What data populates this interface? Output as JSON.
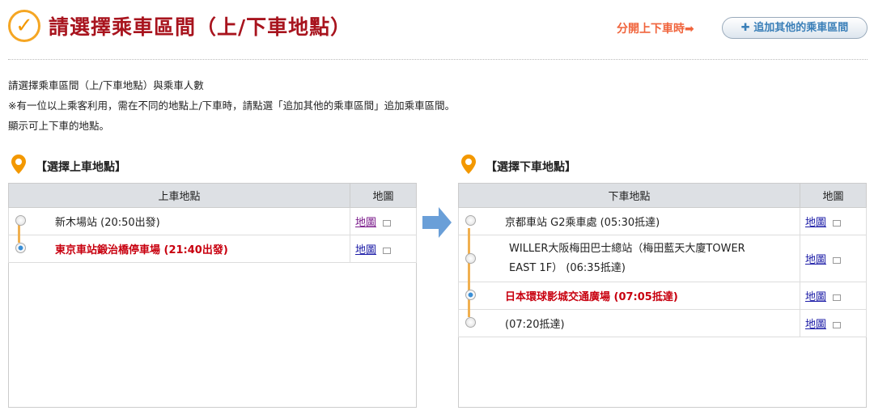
{
  "header": {
    "title": "請選擇乘車區間（上/下車地點）",
    "split_label": "分開上下車時➡",
    "add_button": "✚ 追加其他的乘車區間"
  },
  "intro": [
    "請選擇乘車區間（上/下車地點）與乘車人數",
    "※有一位以上乘客利用，需在不同的地點上/下車時，請點選「追加其他的乘車區間」追加乘車區間。",
    "顯示可上下車的地點。"
  ],
  "boarding": {
    "heading": "【選擇上車地點】",
    "col_stop": "上車地點",
    "col_map": "地圖",
    "rows": [
      {
        "label": "新木場站 (20:50出發)",
        "map": "地圖",
        "selected": false
      },
      {
        "label": "東京車站鍛治橋停車場 (21:40出發)",
        "map": "地圖",
        "selected": true
      }
    ]
  },
  "alighting": {
    "heading": "【選擇下車地點】",
    "col_stop": "下車地點",
    "col_map": "地圖",
    "rows": [
      {
        "label": "京都車站 G2乘車處 (05:30抵達)",
        "map": "地圖",
        "selected": false
      },
      {
        "label": "WILLER大阪梅田巴士總站（梅田藍天大廈TOWER EAST 1F） (06:35抵達)",
        "map": "地圖",
        "selected": false
      },
      {
        "label": "日本環球影城交通廣場 (07:05抵達)",
        "map": "地圖",
        "selected": true
      },
      {
        "label": "(07:20抵達)",
        "map": "地圖",
        "selected": false
      }
    ]
  }
}
